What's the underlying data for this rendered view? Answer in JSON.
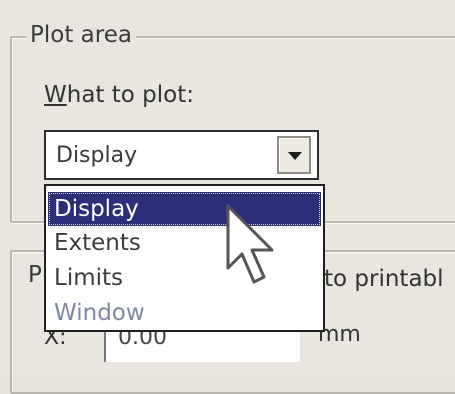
{
  "plot_area": {
    "title": "Plot area",
    "what_to_plot_prefix": "W",
    "what_to_plot_rest": "hat to plot:",
    "selected_value": "Display",
    "options": [
      "Display",
      "Extents",
      "Limits",
      "Window"
    ],
    "selected_index": 0
  },
  "plot_offset": {
    "title_fragment": "P",
    "right_fragment": "to printabl",
    "x_label": "X:",
    "x_value": "0.00",
    "unit": "mm"
  },
  "colors": {
    "selection": "#2d2e79",
    "background": "#e8e6df"
  },
  "icons": {
    "dropdown_arrow": "chevron-down-icon",
    "cursor": "mouse-pointer-icon"
  }
}
